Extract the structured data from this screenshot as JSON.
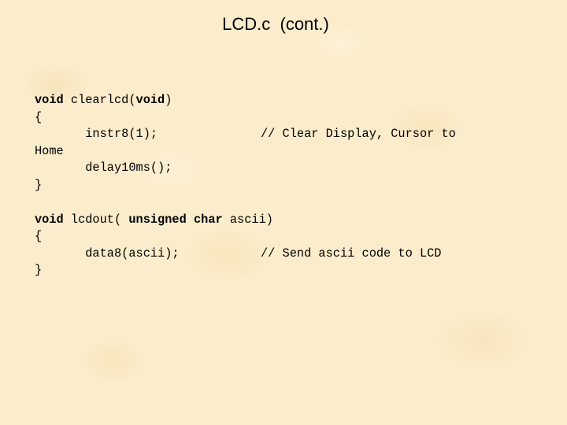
{
  "slide": {
    "title": "LCD.c  (cont.)"
  },
  "code": {
    "block1": {
      "sig_kw1": "void",
      "sig_name": " clearlcd(",
      "sig_kw2": "void",
      "sig_close": ")",
      "open_brace": "{",
      "stmt1": "       instr8(1);",
      "comment1": "// Clear Display, Cursor to",
      "wrap1": "Home",
      "stmt2": "       delay10ms();",
      "close_brace": "}"
    },
    "block2": {
      "sig_kw1": "void",
      "sig_name": " lcdout( ",
      "sig_kw2": "unsigned char",
      "sig_param": " ascii)",
      "open_brace": "{",
      "stmt1": "       data8(ascii);",
      "comment1": "// Send ascii code to LCD",
      "close_brace": "}"
    }
  }
}
